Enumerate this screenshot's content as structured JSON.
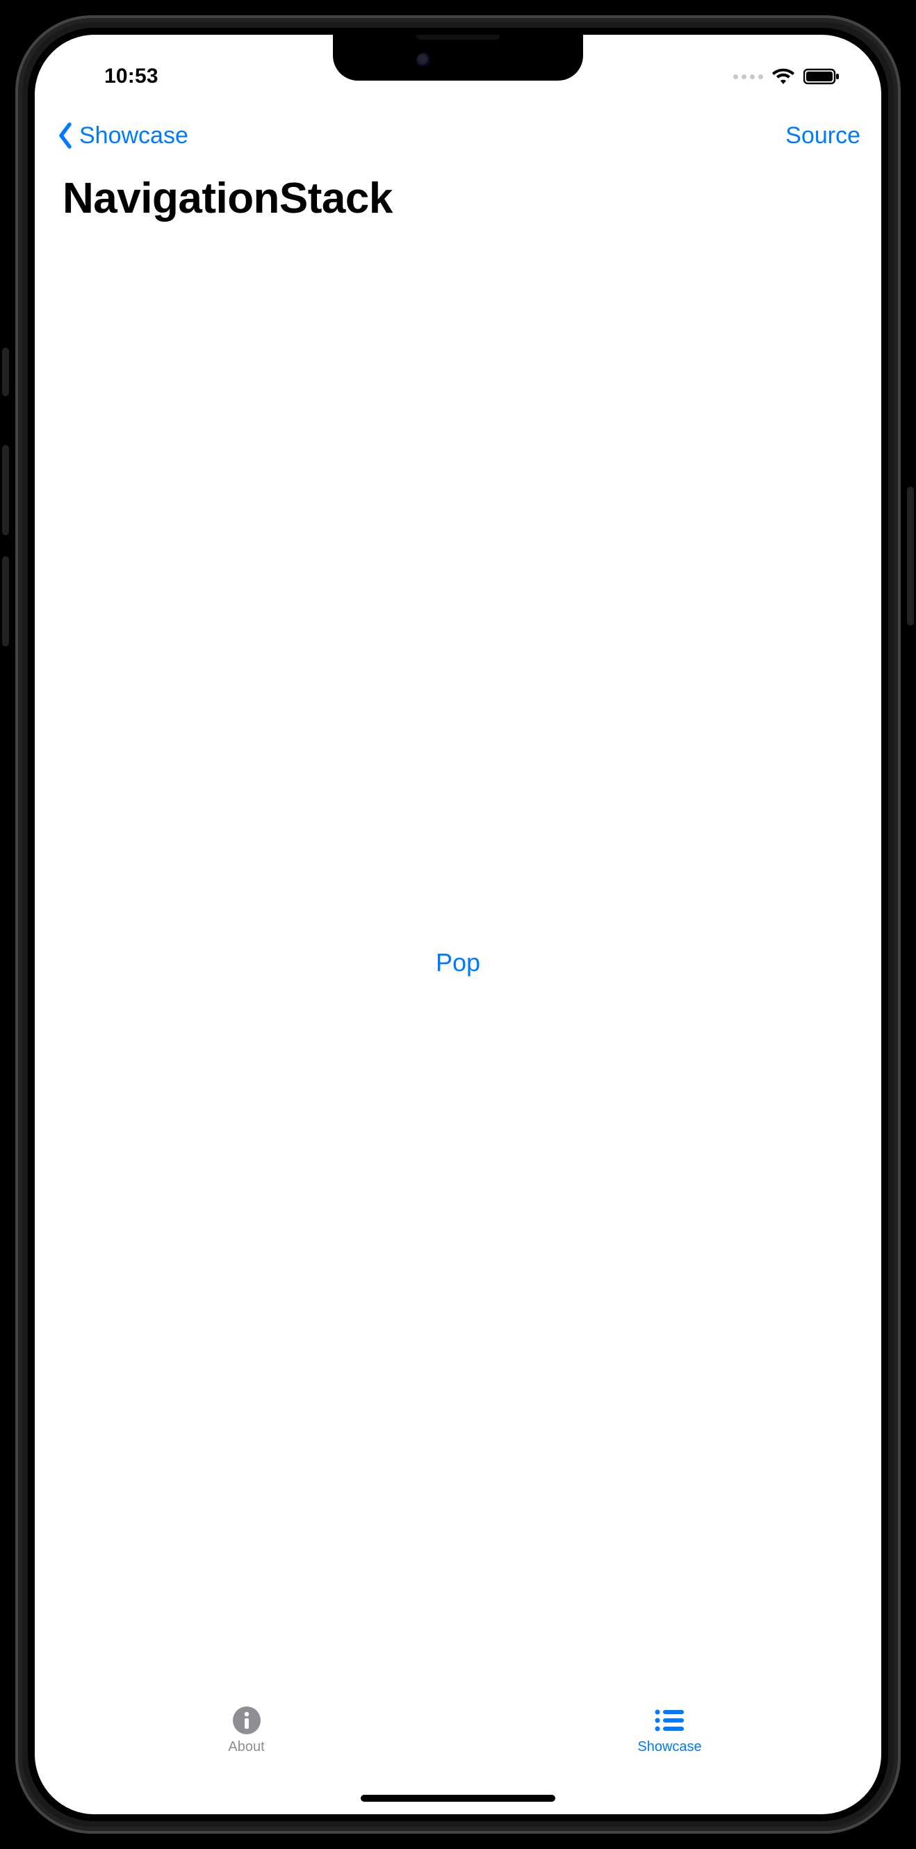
{
  "status": {
    "time": "10:53"
  },
  "nav": {
    "back_label": "Showcase",
    "trailing_label": "Source"
  },
  "page": {
    "title": "NavigationStack"
  },
  "content": {
    "pop_button_label": "Pop"
  },
  "tabs": {
    "items": [
      {
        "label": "About",
        "active": false
      },
      {
        "label": "Showcase",
        "active": true
      }
    ]
  },
  "colors": {
    "tint": "#007AFF",
    "inactive": "#8E8E93"
  }
}
